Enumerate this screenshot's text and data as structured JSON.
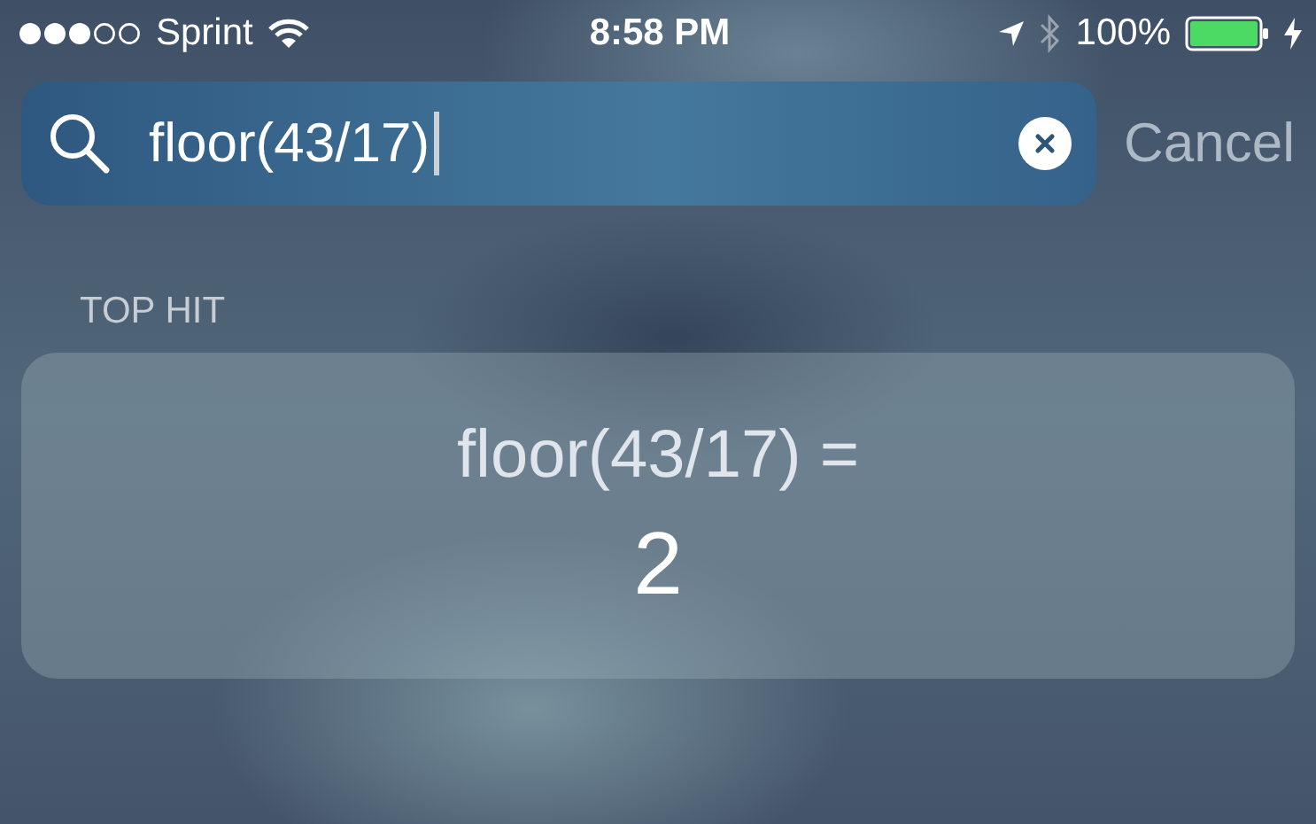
{
  "status_bar": {
    "carrier": "Sprint",
    "time": "8:58 PM",
    "battery": "100%"
  },
  "search": {
    "value": "floor(43/17)"
  },
  "cancel": "Cancel",
  "section_title": "TOP HIT",
  "top_hit": {
    "expression": "floor(43/17) =",
    "result": "2"
  }
}
